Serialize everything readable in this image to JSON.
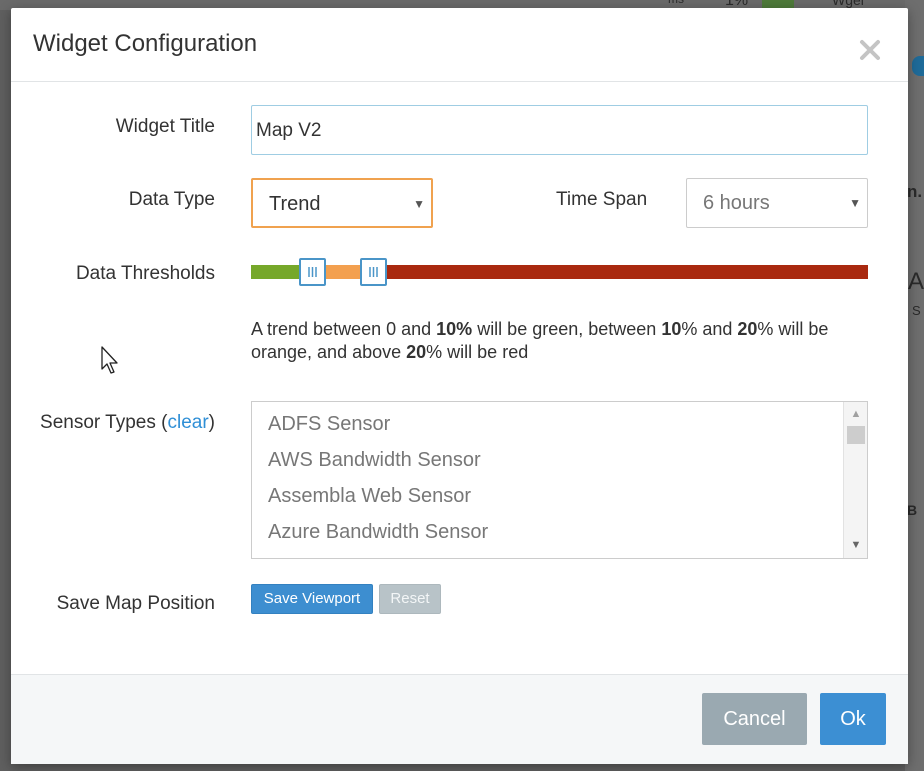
{
  "modal": {
    "title": "Widget Configuration"
  },
  "form": {
    "widget_title_label": "Widget Title",
    "widget_title_value": "Map V2",
    "data_type_label": "Data Type",
    "data_type_value": "Trend",
    "time_span_label": "Time Span",
    "time_span_value": "6 hours",
    "data_thresholds_label": "Data Thresholds",
    "thresholds": {
      "low": 10,
      "high": 20,
      "max_fraction_low": 0.1,
      "max_fraction_high": 0.2,
      "colors": {
        "green": "#76a82a",
        "orange": "#f3a04f",
        "red": "#a9290f"
      },
      "description": {
        "p1": "A trend between 0 and ",
        "b1": "10%",
        "p2": " will be green, between ",
        "b2": "10",
        "p3": "% and ",
        "b3": "20",
        "p4": "% will be orange, and above ",
        "b4": "20",
        "p5": "% will be red"
      }
    },
    "sensor_types_label_prefix": "Sensor Types (",
    "sensor_types_clear": "clear",
    "sensor_types_label_suffix": ")",
    "sensor_types": [
      "ADFS Sensor",
      "AWS Bandwidth Sensor",
      "Assembla Web Sensor",
      "Azure Bandwidth Sensor"
    ],
    "save_map_position_label": "Save Map Position",
    "save_viewport_button": "Save Viewport",
    "reset_button": "Reset"
  },
  "footer": {
    "cancel_button": "Cancel",
    "ok_button": "Ok"
  },
  "background": {
    "top_text_1": "ms",
    "top_text_2": "1%",
    "top_text_3": "Wgel",
    "side_text_1": "n.",
    "side_text_2": "A",
    "side_text_3": "S",
    "side_text_4": "B"
  },
  "colors": {
    "accent_blue": "#3c8fd3",
    "select_focus_orange": "#f0a24f",
    "link_blue": "#2f8fd6"
  }
}
